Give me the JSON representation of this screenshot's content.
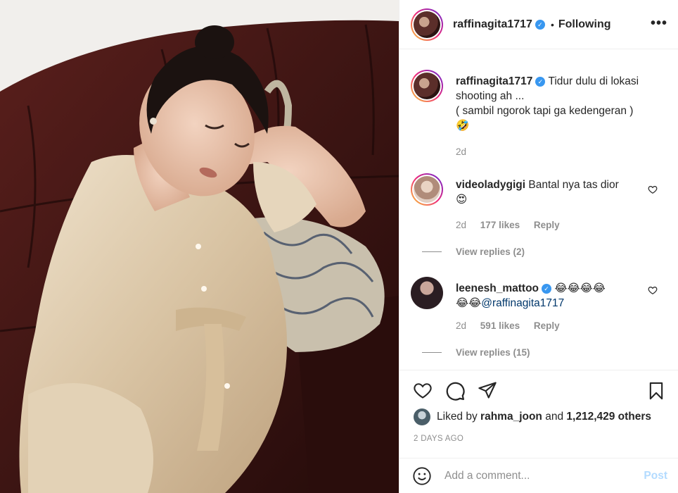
{
  "header": {
    "username": "raffinagita1717",
    "separator": "•",
    "follow_status": "Following",
    "more_icon": "more-horizontal-icon"
  },
  "caption": {
    "username": "raffinagita1717",
    "line1": "Tidur dulu di lokasi",
    "line2": "shooting ah ...",
    "line3": "( sambil ngorok tapi ga kedengeran )",
    "emoji": "🤣",
    "time": "2d"
  },
  "comments": [
    {
      "username": "videoladygigi",
      "text": "Bantal nya tas dior",
      "emoji": "😍",
      "time": "2d",
      "likes": "177 likes",
      "reply": "Reply",
      "view_replies": "View replies (2)"
    },
    {
      "username": "leenesh_mattoo",
      "text_emoji_line1": "😂😂😂😂",
      "text_emoji_line2": "😂😂",
      "mention": "@raffinagita1717",
      "time": "2d",
      "likes": "591 likes",
      "reply": "Reply",
      "view_replies": "View replies (15)"
    }
  ],
  "liked_by": {
    "prefix": "Liked by",
    "user": "rahma_joon",
    "middle": "and",
    "others": "1,212,429 others"
  },
  "timestamp": "2 DAYS AGO",
  "add_comment": {
    "placeholder": "Add a comment...",
    "post_label": "Post"
  },
  "colors": {
    "verified": "#3897f0",
    "mention": "#00376b",
    "post_disabled": "#b3dbff",
    "muted": "#8e8e8e"
  }
}
